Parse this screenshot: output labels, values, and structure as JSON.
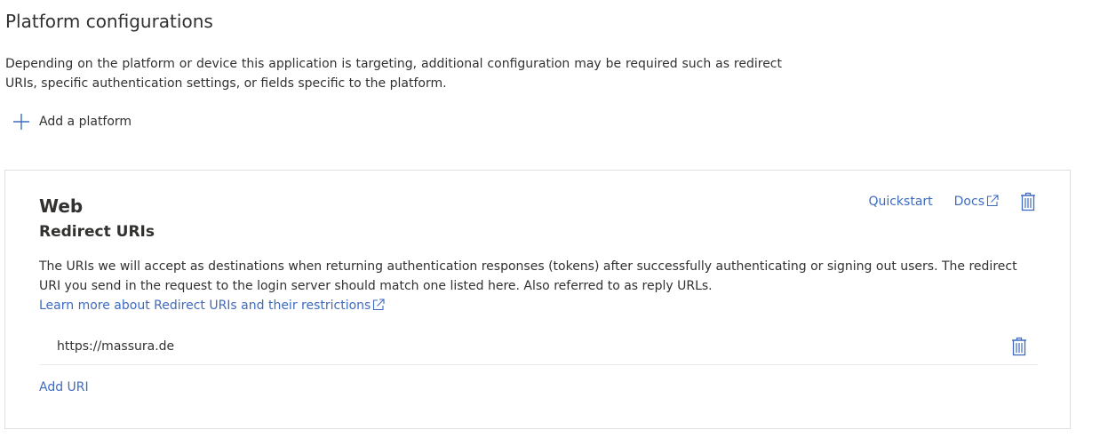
{
  "page": {
    "title": "Platform configurations",
    "description": "Depending on the platform or device this application is targeting, additional configuration may be required such as redirect URIs, specific authentication settings, or fields specific to the platform.",
    "add_platform_label": "Add a platform"
  },
  "web_card": {
    "title": "Web",
    "subtitle": "Redirect URIs",
    "quickstart_label": "Quickstart",
    "docs_label": "Docs",
    "description_text": "The URIs we will accept as destinations when returning authentication responses (tokens) after successfully authenticating or signing out users. The redirect URI you send in the request to the login server should match one listed here. Also referred to as reply URLs. ",
    "learn_more_label": "Learn more about Redirect URIs and their restrictions",
    "redirect_uris": [
      "https://massura.de"
    ],
    "add_uri_label": "Add URI"
  },
  "colors": {
    "link": "#3f6bbf",
    "text": "#323130",
    "border": "#e1dfdd"
  },
  "icons": {
    "add": "plus-icon",
    "external": "external-link-icon",
    "delete": "trash-icon"
  }
}
